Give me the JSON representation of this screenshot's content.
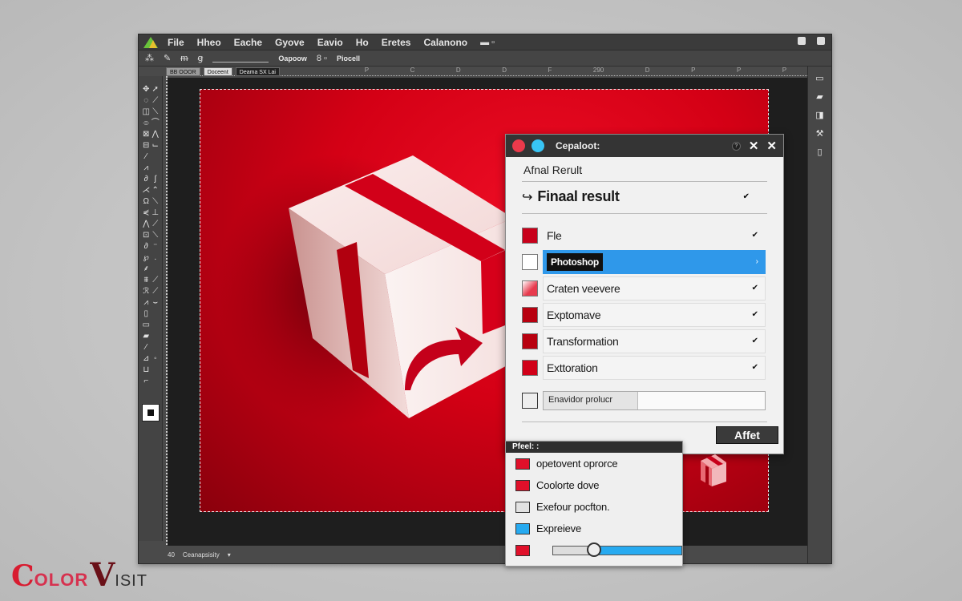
{
  "menubar": {
    "items": [
      "File",
      "Hheo",
      "Eache",
      "Gyove",
      "Eavio",
      "Ho",
      "Eretes",
      "Calanono"
    ]
  },
  "optionsbar": {
    "label1": "Oapoow",
    "label2": "Piocell"
  },
  "doc_tabs": [
    "BB OOOR",
    "Doceent",
    "Deama SX Lai"
  ],
  "ruler_ticks": [
    "P",
    "C",
    "D",
    "D",
    "F",
    "290",
    "D",
    "P",
    "P",
    "P"
  ],
  "statusbar": {
    "zoom": "40",
    "doc_info": "Ceanapsisity"
  },
  "colors": {
    "accent_blue": "#2f98ea",
    "brand_red": "#d40015",
    "dialog_dark": "#343434"
  },
  "dialog": {
    "title": "Cepaloot:",
    "subtitle": "Afnal Rerult",
    "heading": "Finaal result",
    "rows": [
      {
        "label": "Fle",
        "swatch": "#c8001a",
        "selected": false,
        "caret": "✔"
      },
      {
        "label": "Photoshop",
        "swatch": "#ffffff",
        "selected": true,
        "caret": "›"
      },
      {
        "label": "Craten veevere",
        "swatch": "#e73a4d",
        "selected": false,
        "caret": "✔"
      },
      {
        "label": "Exptomave",
        "swatch": "#b8000f",
        "selected": false,
        "caret": "✔"
      },
      {
        "label": "Transformation",
        "swatch": "#b8000f",
        "selected": false,
        "caret": "✔"
      },
      {
        "label": "Exttoration",
        "swatch": "#d10018",
        "selected": false,
        "caret": "✔"
      }
    ],
    "input_value": "Enavidor prolucr",
    "apply_label": "Affet"
  },
  "subpanel": {
    "title": "Pfeel: :",
    "items": [
      {
        "label": "opetovent oprorce",
        "swatch": "#e0102a"
      },
      {
        "label": "Coolorte dove",
        "swatch": "#e0102a"
      },
      {
        "label": "Exefour pocfton.",
        "swatch": "#e2e2e2"
      },
      {
        "label": "Expreieve",
        "swatch": "#27aaf0"
      }
    ],
    "slider_swatch": "#e0102a",
    "slider_value_pct": 32
  },
  "watermark": {
    "part1": "C",
    "part2": "OLOR",
    "part3": "V",
    "part4": "ISIT"
  }
}
